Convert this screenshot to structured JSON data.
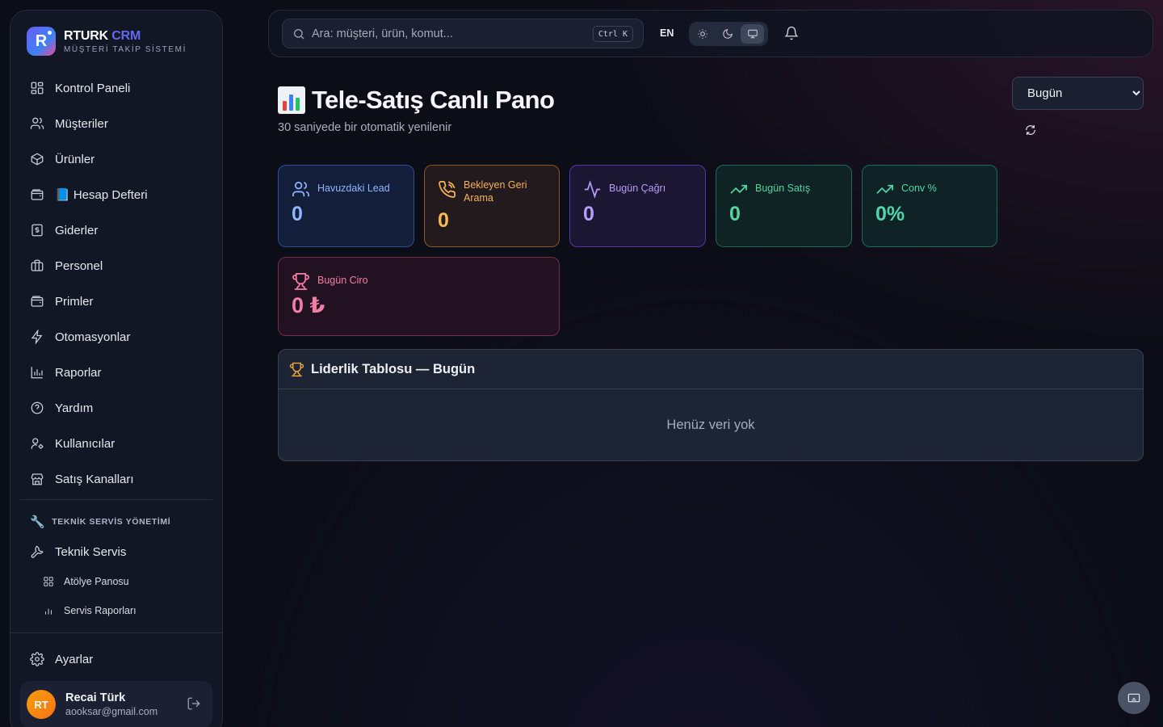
{
  "brand": {
    "name_main": "RTURK",
    "name_accent": "CRM",
    "subtitle": "MÜŞTERİ TAKİP SİSTEMİ",
    "logo_letter": "R"
  },
  "sidebar": {
    "items": [
      {
        "label": "Kontrol Paneli",
        "icon": "dashboard-icon"
      },
      {
        "label": "Müşteriler",
        "icon": "users-icon"
      },
      {
        "label": "Ürünler",
        "icon": "package-icon"
      },
      {
        "label": "📘 Hesap Defteri",
        "icon": "wallet-icon"
      },
      {
        "label": "Giderler",
        "icon": "receipt-icon"
      },
      {
        "label": "Personel",
        "icon": "briefcase-icon"
      },
      {
        "label": "Primler",
        "icon": "wallet-icon"
      },
      {
        "label": "Otomasyonlar",
        "icon": "zap-icon"
      },
      {
        "label": "Raporlar",
        "icon": "bar-chart-icon"
      },
      {
        "label": "Yardım",
        "icon": "help-circle-icon"
      },
      {
        "label": "Kullanıcılar",
        "icon": "user-cog-icon"
      },
      {
        "label": "Satış Kanalları",
        "icon": "store-icon"
      }
    ],
    "section_title": "TEKNİK SERVİS YÖNETİMİ",
    "section_item": "Teknik Servis",
    "sub_items": [
      "Atölye Panosu",
      "Servis Raporları"
    ],
    "settings_label": "Ayarlar"
  },
  "user": {
    "initials": "RT",
    "name": "Recai Türk",
    "email": "aooksar@gmail.com"
  },
  "topbar": {
    "search_placeholder": "Ara: müşteri, ürün, komut...",
    "shortcut": "Ctrl K",
    "language": "EN"
  },
  "header": {
    "title": "Tele-Satış Canlı Pano",
    "subtitle": "30 saniyede bir otomatik yenilenir",
    "period": "Bugün"
  },
  "stats": {
    "lead_pool": {
      "label": "Havuzdaki Lead",
      "value": "0"
    },
    "pending_callback": {
      "label": "Bekleyen Geri Arama",
      "value": "0"
    },
    "calls_today": {
      "label": "Bugün Çağrı",
      "value": "0"
    },
    "sales_today": {
      "label": "Bugün Satış",
      "value": "0"
    },
    "conversion": {
      "label": "Conv %",
      "value": "0%"
    },
    "revenue_today": {
      "label": "Bugün Ciro",
      "value": "0 ₺"
    }
  },
  "leaderboard": {
    "title": "Liderlik Tablosu — Bugün",
    "empty_text": "Henüz veri yok"
  },
  "colors": {
    "accent": "#6366f1",
    "lead": "#8fb6ff",
    "callback": "#f8b257",
    "calls": "#b79cfa",
    "sales": "#55d59f",
    "revenue": "#f37da5"
  }
}
